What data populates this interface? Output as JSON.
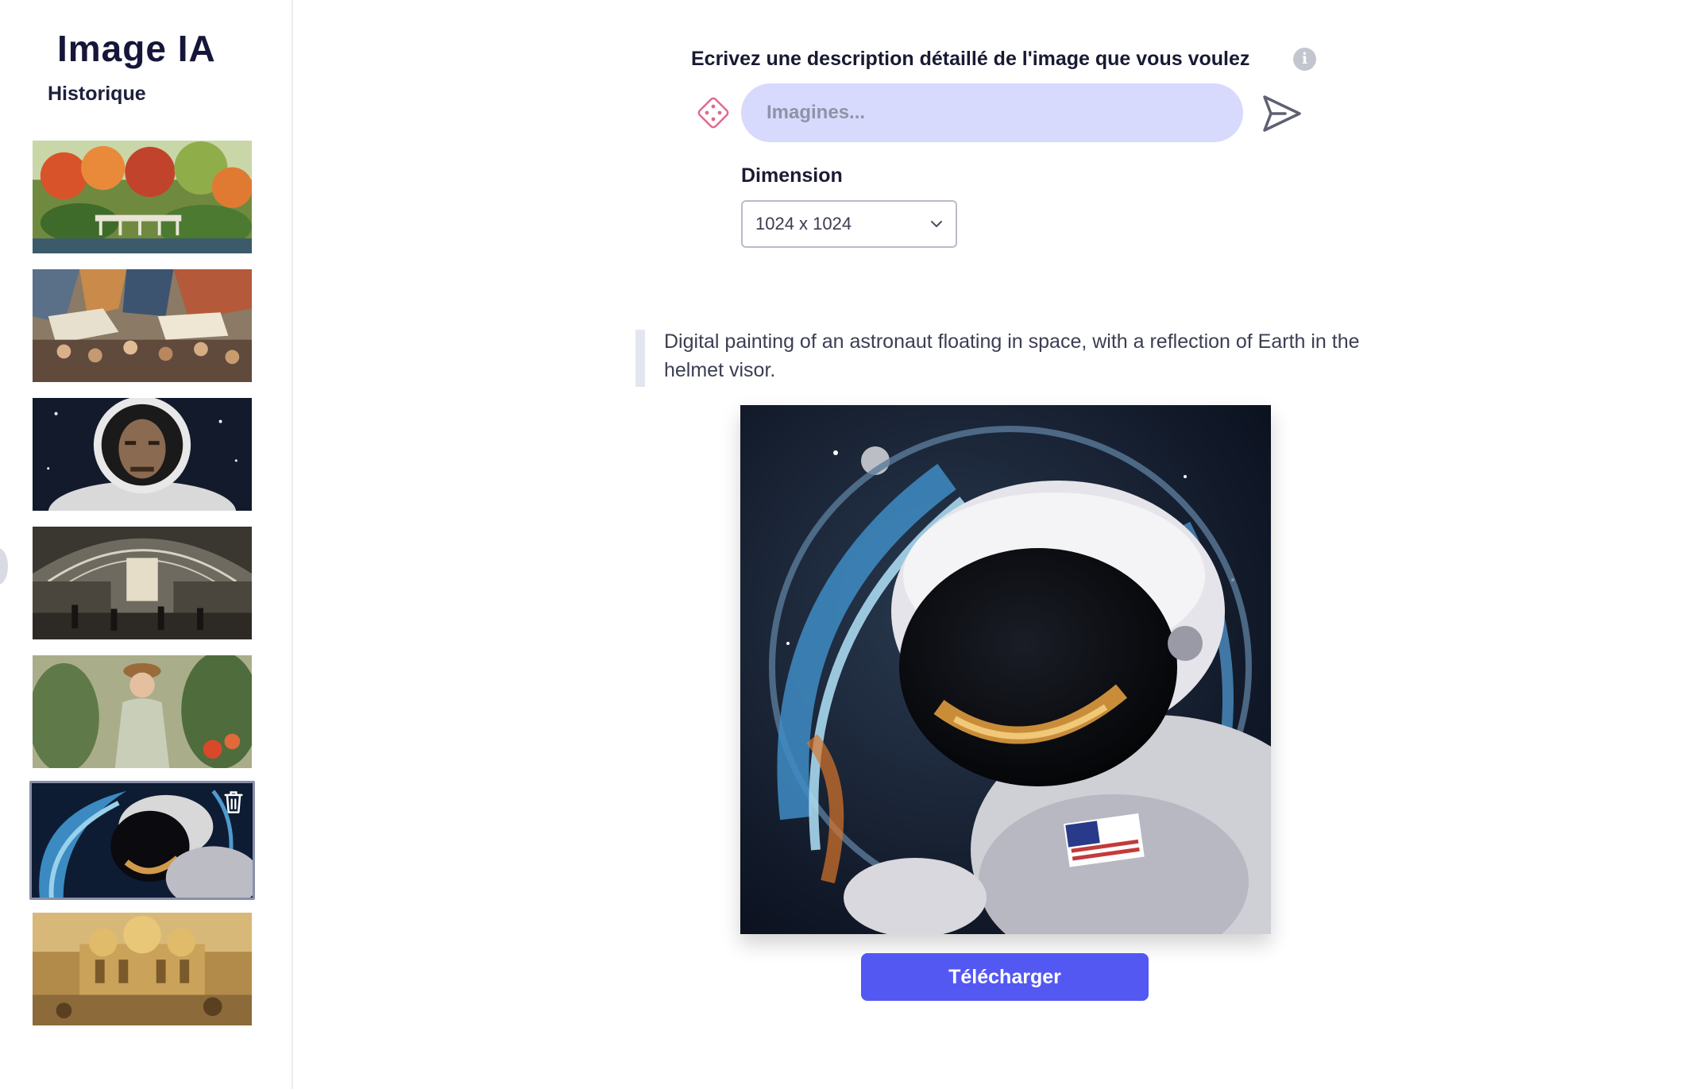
{
  "app": {
    "title": "Image IA"
  },
  "sidebar": {
    "history_title": "Historique",
    "items": [
      {
        "subject": "japanese-garden-bridge",
        "selected": false
      },
      {
        "subject": "cubist-market-crowd",
        "selected": false
      },
      {
        "subject": "astronaut-portrait-bw",
        "selected": false
      },
      {
        "subject": "train-station-hall",
        "selected": false
      },
      {
        "subject": "woman-in-greenhouse",
        "selected": false
      },
      {
        "subject": "astronaut-earth-reflection",
        "selected": true
      },
      {
        "subject": "golden-palace",
        "selected": false
      }
    ]
  },
  "main": {
    "prompt_label": "Ecrivez une description détaillé de l'image que vous voulez",
    "info_icon": "i",
    "prompt_placeholder": "Imagines...",
    "prompt_value": "",
    "dimension_label": "Dimension",
    "dimension_value": "1024 x 1024",
    "description": "Digital painting of an astronaut floating in space, with a reflection of Earth in the helmet visor.",
    "download_label": "Télécharger"
  },
  "colors": {
    "accent": "#5458f2",
    "input_bg": "#d7dafc",
    "dice": "#e06a8e"
  }
}
